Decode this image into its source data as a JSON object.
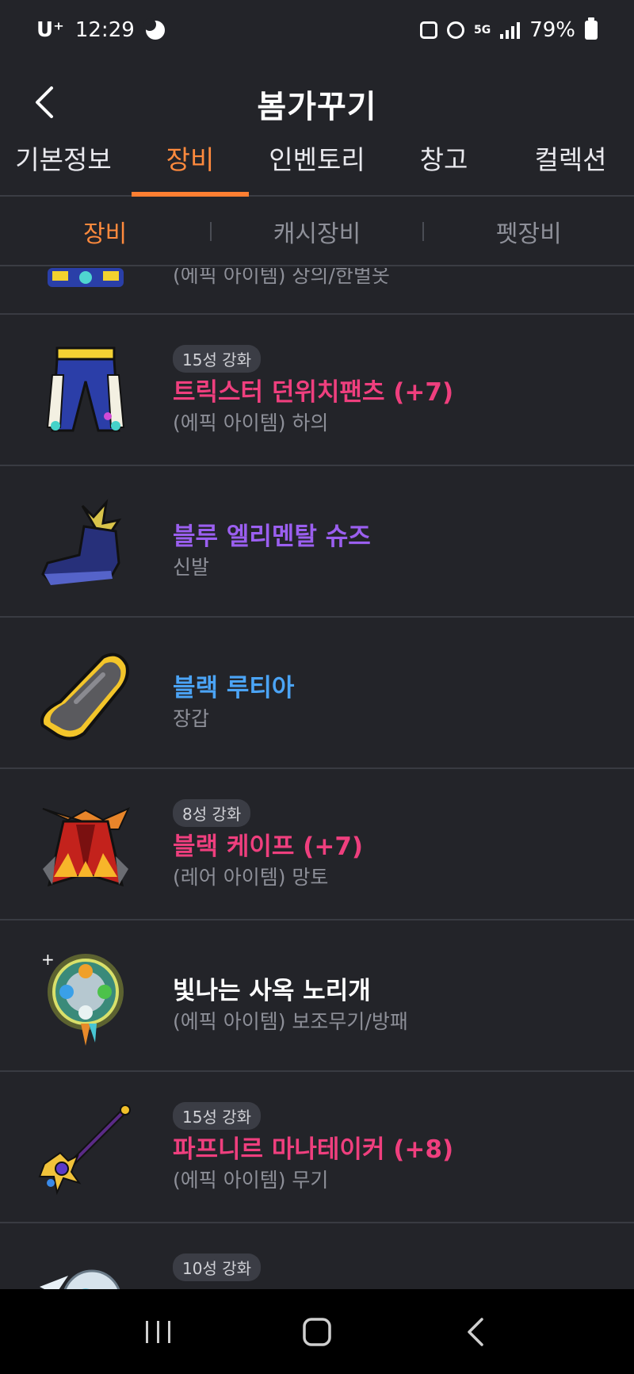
{
  "status": {
    "carrier": "U⁺",
    "time": "12:29",
    "network": "5G",
    "battery": "79%"
  },
  "header": {
    "title": "봄가꾸기"
  },
  "tabs": [
    {
      "label": "기본정보"
    },
    {
      "label": "장비"
    },
    {
      "label": "인벤토리"
    },
    {
      "label": "창고"
    },
    {
      "label": "컬렉션"
    }
  ],
  "subtabs": [
    {
      "label": "장비"
    },
    {
      "label": "캐시장비"
    },
    {
      "label": "펫장비"
    }
  ],
  "items": [
    {
      "badge": "",
      "name": "",
      "sub": "(에픽 아이템) 상의/한벌옷",
      "color": "#ef3f7e",
      "icon": "overall-icon"
    },
    {
      "badge": "15성 강화",
      "name": "트릭스터 던위치팬츠 (+7)",
      "sub": "(에픽 아이템) 하의",
      "color": "#ef3f7e",
      "icon": "pants-icon"
    },
    {
      "badge": "",
      "name": "블루 엘리멘탈 슈즈",
      "sub": "신발",
      "color": "#9b5ff0",
      "icon": "shoes-icon"
    },
    {
      "badge": "",
      "name": "블랙 루티아",
      "sub": "장갑",
      "color": "#4ba4f6",
      "icon": "glove-icon"
    },
    {
      "badge": "8성 강화",
      "name": "블랙 케이프 (+7)",
      "sub": "(레어 아이템) 망토",
      "color": "#ef3f7e",
      "icon": "cape-icon"
    },
    {
      "badge": "",
      "name": "빛나는 사옥 노리개",
      "sub": "(에픽 아이템) 보조무기/방패",
      "color": "#ffffff",
      "icon": "norigae-icon"
    },
    {
      "badge": "15성 강화",
      "name": "파프니르 마나테이커 (+8)",
      "sub": "(에픽 아이템) 무기",
      "color": "#ef3f7e",
      "icon": "staff-icon"
    },
    {
      "badge": "10성 강화",
      "name": "",
      "sub": "",
      "color": "#ef3f7e",
      "icon": "emblem-icon"
    }
  ]
}
